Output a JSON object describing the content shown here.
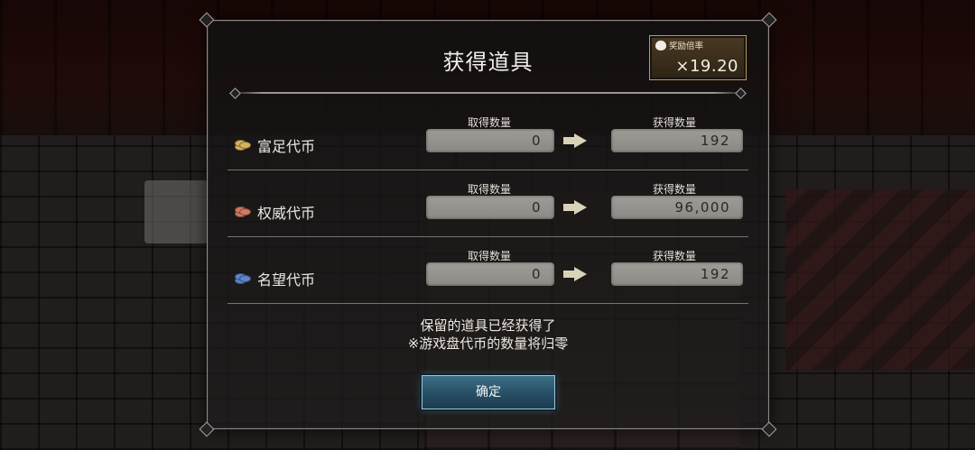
{
  "dialog": {
    "title": "获得道具",
    "multiplier": {
      "label": "奖励倍率",
      "value": "×19.20"
    },
    "rows": [
      {
        "name": "富足代币",
        "coin": "gold-coin-icon",
        "taken_label": "取得数量",
        "taken_value": "0",
        "gained_label": "获得数量",
        "gained_value": "192"
      },
      {
        "name": "权威代币",
        "coin": "red-coin-icon",
        "taken_label": "取得数量",
        "taken_value": "0",
        "gained_label": "获得数量",
        "gained_value": "96,000"
      },
      {
        "name": "名望代币",
        "coin": "blue-coin-icon",
        "taken_label": "取得数量",
        "taken_value": "0",
        "gained_label": "获得数量",
        "gained_value": "192"
      }
    ],
    "notice_line1": "保留的道具已经获得了",
    "notice_line2": "※游戏盘代币的数量将归零",
    "confirm_label": "确定"
  },
  "colors": {
    "gold_coin": "#d8b45a",
    "red_coin": "#d07a64",
    "blue_coin": "#5f86c9",
    "button": "#264e64"
  }
}
